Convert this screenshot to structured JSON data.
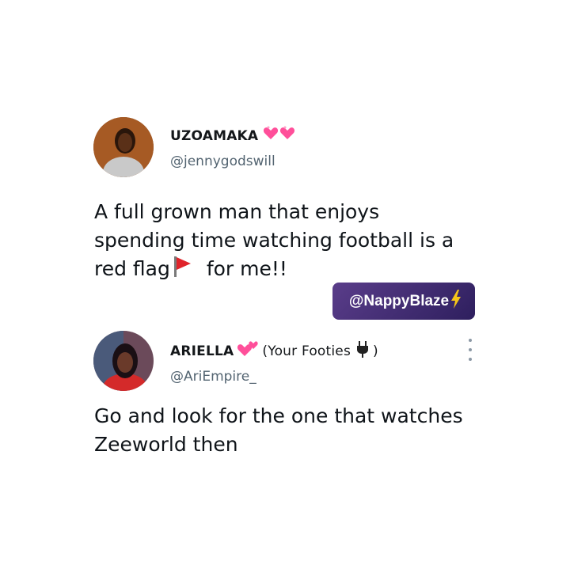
{
  "tweet1": {
    "display_name": "UZOAMAKA",
    "name_emojis": "heart-emojis",
    "handle": "@jennygodswill",
    "body_line1": "A full grown man that enjoys",
    "body_line2": "spending time watching football is a",
    "body_line3_part1": "red flag",
    "body_line3_part2": " for me!!"
  },
  "watermark": {
    "label": "@NappyBlaze",
    "icon": "lightning-icon"
  },
  "tweet2": {
    "display_name": "ARIELLA",
    "name_extra_open": "(Your Footies",
    "name_extra_close": ")",
    "handle": "@AriEmpire_",
    "body_line1": "Go and look for the one that watches",
    "body_line2": "Zeeworld then"
  },
  "colors": {
    "text": "#0f1419",
    "muted": "#536471",
    "watermark_bg": "#3d2a72",
    "heart": "#ff4f9a"
  }
}
